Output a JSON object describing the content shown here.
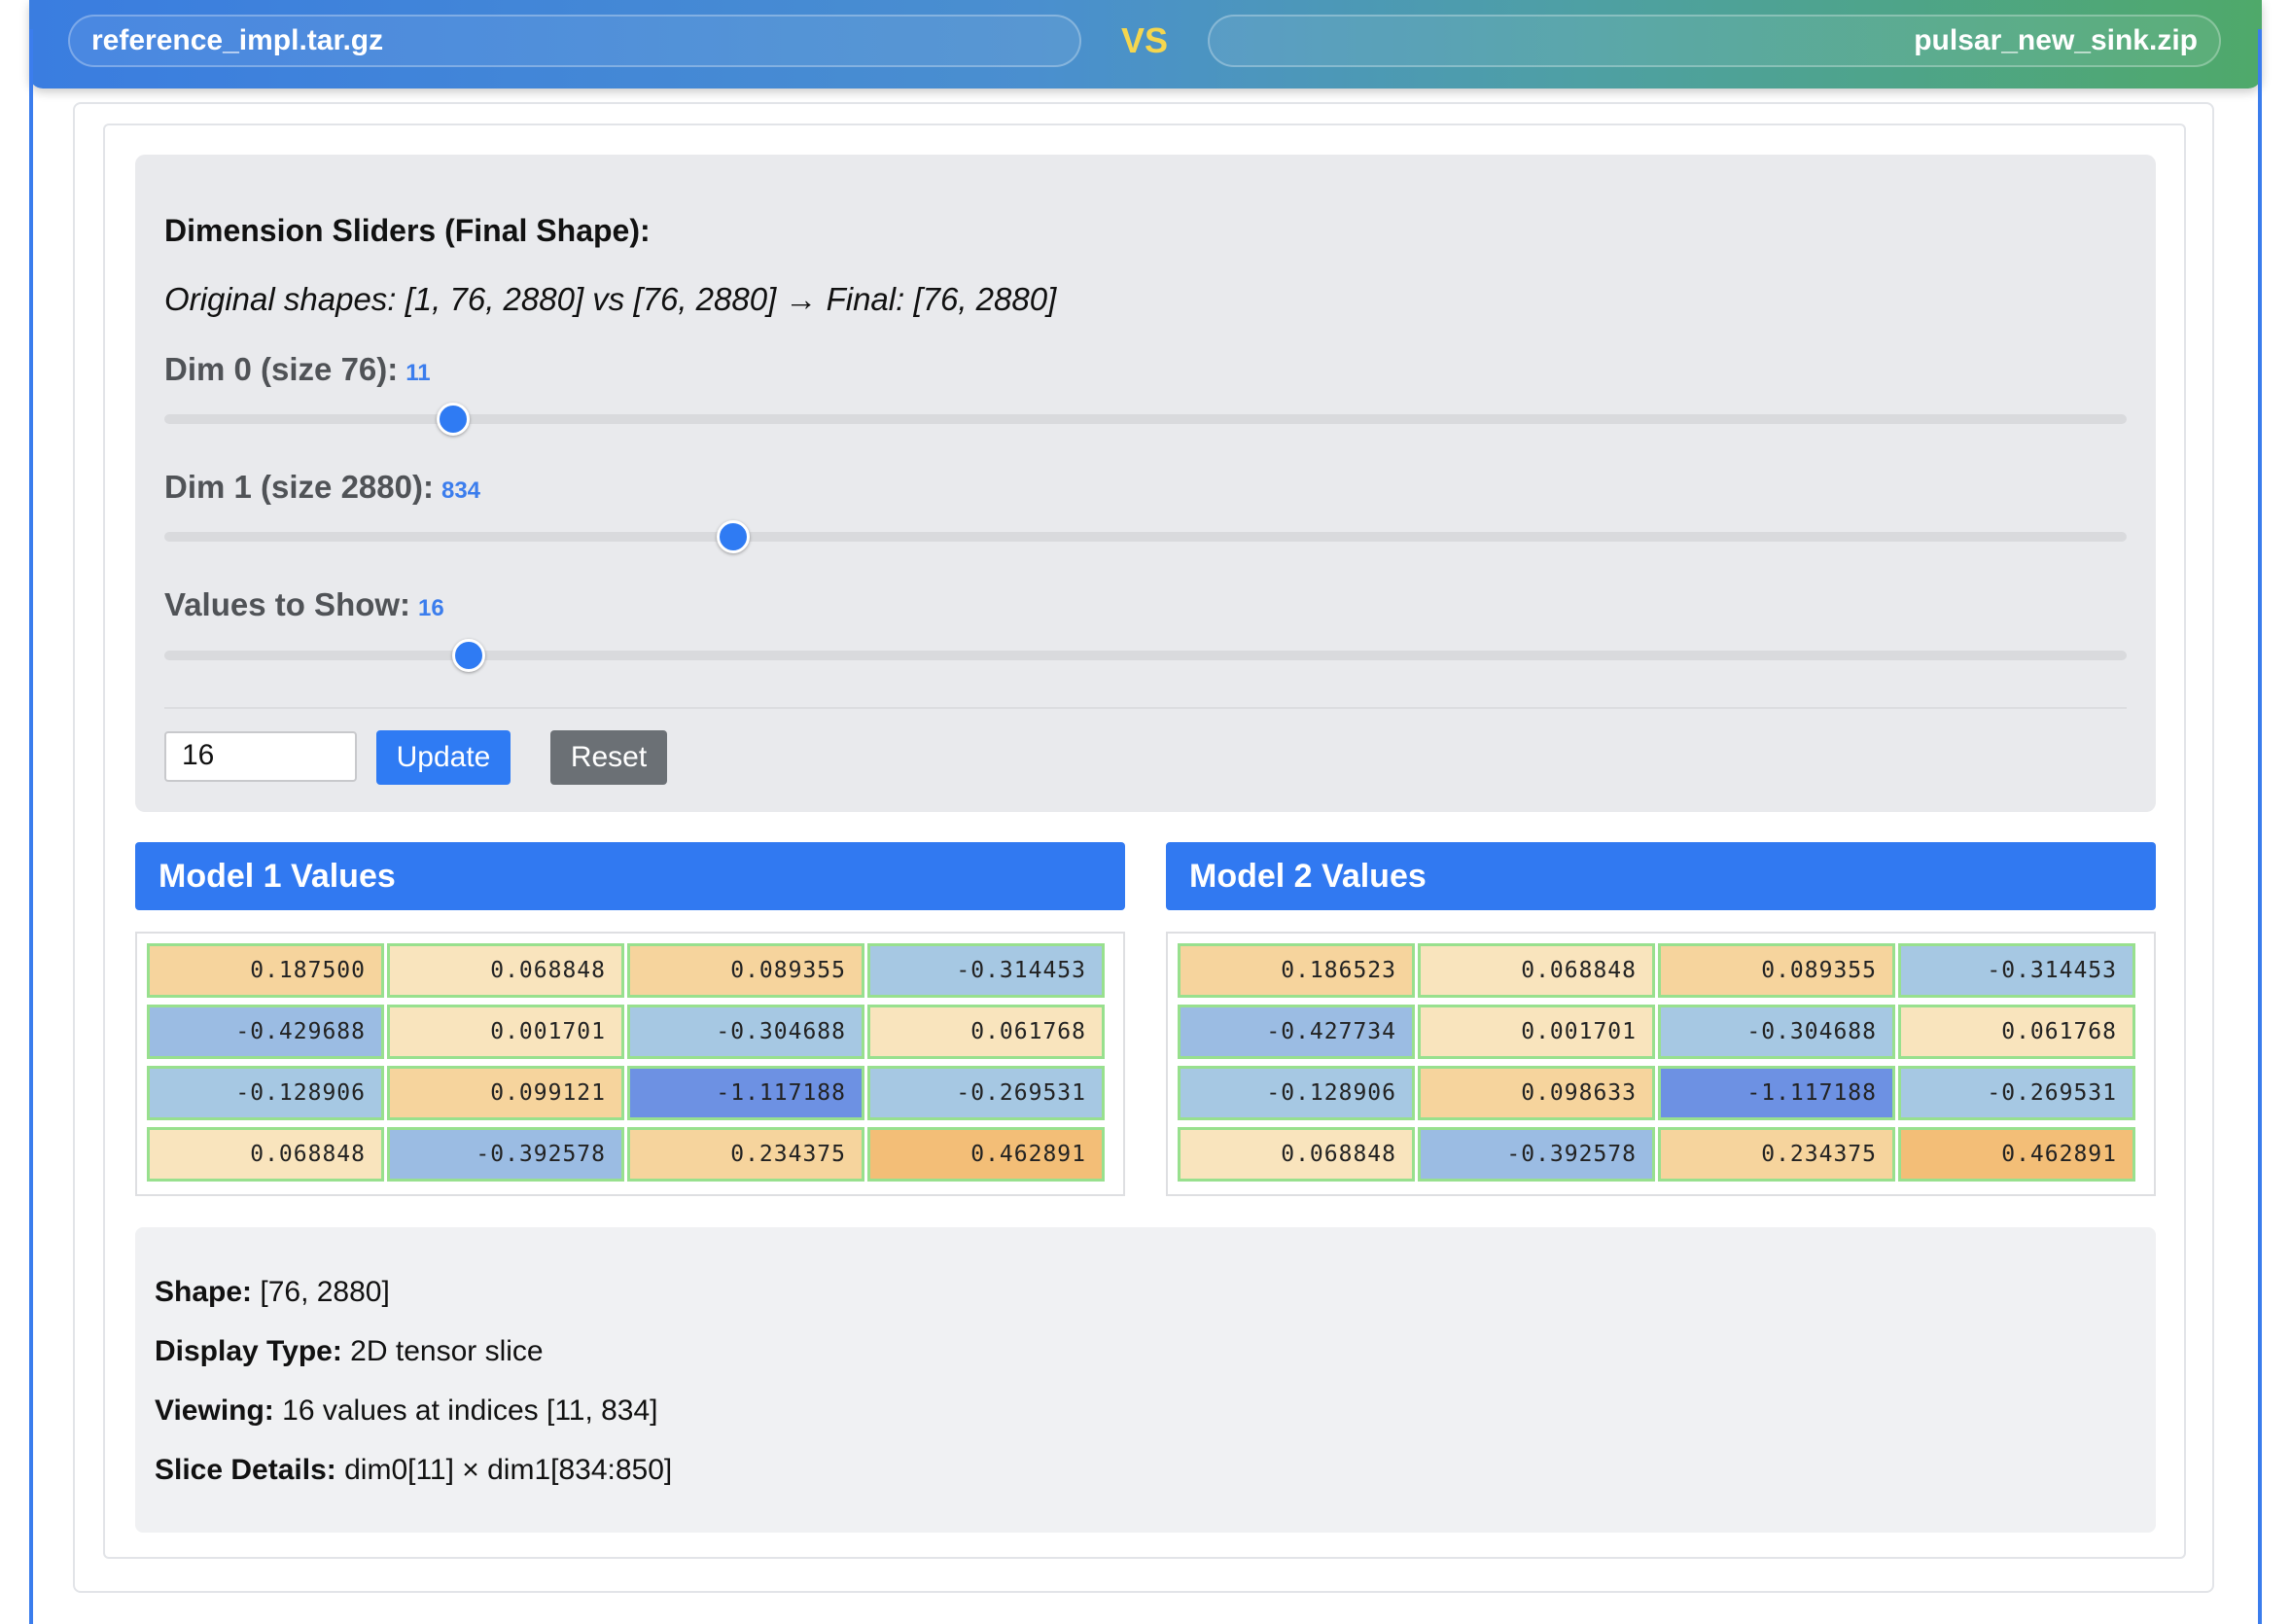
{
  "header": {
    "left_file": "reference_impl.tar.gz",
    "vs_label": "VS",
    "right_file": "pulsar_new_sink.zip"
  },
  "controls": {
    "title": "Dimension Sliders (Final Shape):",
    "shapes_text": "Original shapes: [1, 76, 2880] vs [76, 2880] → Final: [76, 2880]",
    "sliders": [
      {
        "label": "Dim 0 (size 76):",
        "value": "11",
        "level": 0.147
      },
      {
        "label": "Dim 1 (size 2880):",
        "value": "834",
        "level": 0.29
      },
      {
        "label": "Values to Show:",
        "value": "16",
        "level": 0.155
      }
    ],
    "input_value": "16",
    "update_label": "Update",
    "reset_label": "Reset"
  },
  "colors": {
    "accent": "#3179f1",
    "cell_border": "#98e08e",
    "positive_low": "#f9e4bd",
    "positive_mid": "#f6d49d",
    "positive_high": "#f3be77",
    "negative_low": "#a6c8e3",
    "negative_mid": "#9bbce3",
    "negative_high": "#6d91e3"
  },
  "model1": {
    "title": "Model 1 Values",
    "values": [
      "0.187500",
      "0.068848",
      "0.089355",
      "-0.314453",
      "-0.429688",
      "0.001701",
      "-0.304688",
      "0.061768",
      "-0.128906",
      "0.099121",
      "-1.117188",
      "-0.269531",
      "0.068848",
      "-0.392578",
      "0.234375",
      "0.462891"
    ]
  },
  "model2": {
    "title": "Model 2 Values",
    "values": [
      "0.186523",
      "0.068848",
      "0.089355",
      "-0.314453",
      "-0.427734",
      "0.001701",
      "-0.304688",
      "0.061768",
      "-0.128906",
      "0.098633",
      "-1.117188",
      "-0.269531",
      "0.068848",
      "-0.392578",
      "0.234375",
      "0.462891"
    ]
  },
  "info": {
    "shape_label": "Shape:",
    "shape_value": " [76, 2880]",
    "display_label": "Display Type:",
    "display_value": " 2D tensor slice",
    "viewing_label": "Viewing:",
    "viewing_value": " 16 values at indices [11, 834]",
    "slice_label": "Slice Details:",
    "slice_value": " dim0[11] × dim1[834:850]"
  }
}
